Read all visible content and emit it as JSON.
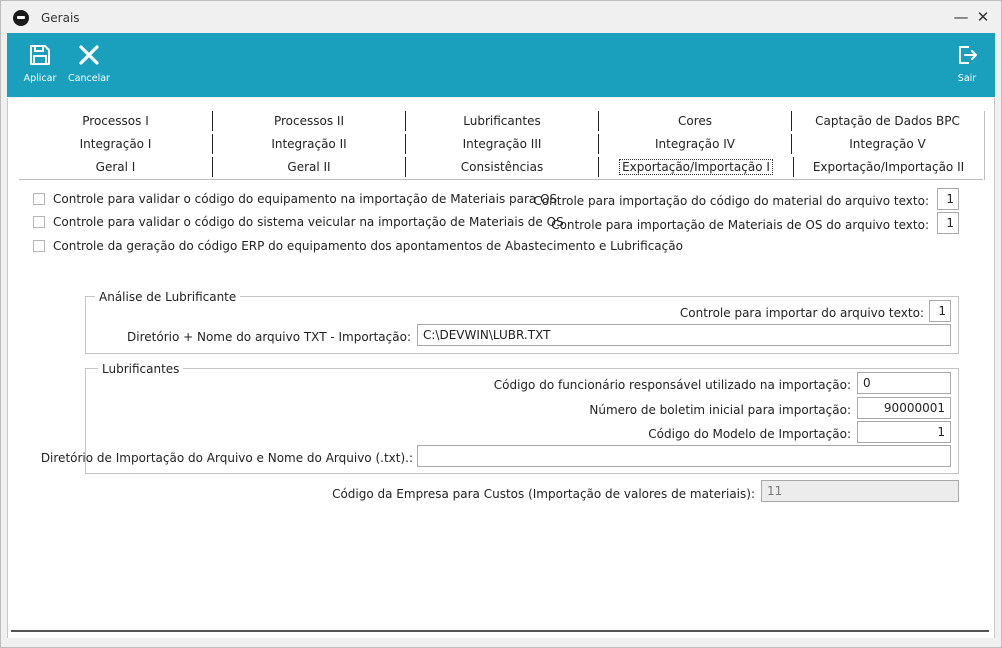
{
  "window": {
    "title": "Gerais",
    "minimize_icon": "minimize-icon",
    "close_icon": "close-icon"
  },
  "toolbar": {
    "apply_label": "Aplicar",
    "apply_icon": "save-icon",
    "cancel_label": "Cancelar",
    "cancel_icon": "x-icon",
    "exit_label": "Sair",
    "exit_icon": "exit-icon",
    "accent_color": "#1aa0bd"
  },
  "tabs": {
    "row1": [
      "Processos I",
      "Processos II",
      "Lubrificantes",
      "Cores",
      "Captação de Dados BPC"
    ],
    "row2": [
      "Integração I",
      "Integração II",
      "Integração III",
      "Integração IV",
      "Integração V"
    ],
    "row3": [
      "Geral I",
      "Geral II",
      "Consistências",
      "Exportação/Importação I",
      "Exportação/Importação II"
    ],
    "active": "Exportação/Importação I"
  },
  "checkboxes": [
    {
      "label": "Controle para validar o código do equipamento na importação de Materiais para OS",
      "checked": false
    },
    {
      "label": "Controle para validar o código do sistema veicular na importação de Materiais de OS",
      "checked": false
    },
    {
      "label": "Controle da geração do código ERP do equipamento dos apontamentos de Abastecimento e Lubrificação",
      "checked": false
    }
  ],
  "right_controls": [
    {
      "label": "Controle para importação do código do material do arquivo texto:",
      "value": "1"
    },
    {
      "label": "Controle para importação de Materiais de OS do arquivo texto:",
      "value": "1"
    }
  ],
  "analise": {
    "legend": "Análise de Lubrificante",
    "import_control_label": "Controle para importar do arquivo texto:",
    "import_control_value": "1",
    "dir_label": "Diretório + Nome do arquivo TXT - Importação:",
    "dir_value": "C:\\DEVWIN\\LUBR.TXT"
  },
  "lubrificantes": {
    "legend": "Lubrificantes",
    "employee_label": "Código do funcionário responsável utilizado na importação:",
    "employee_value": "0",
    "bulletin_label": "Número de boletim inicial para importação:",
    "bulletin_value": "90000001",
    "model_label": "Código do Modelo de Importação:",
    "model_value": "1",
    "dir_label": "Diretório de Importação do Arquivo e Nome do Arquivo (.txt).:",
    "dir_value": ""
  },
  "company": {
    "label": "Código da Empresa para Custos (Importação de valores de materiais):",
    "value": "11"
  }
}
